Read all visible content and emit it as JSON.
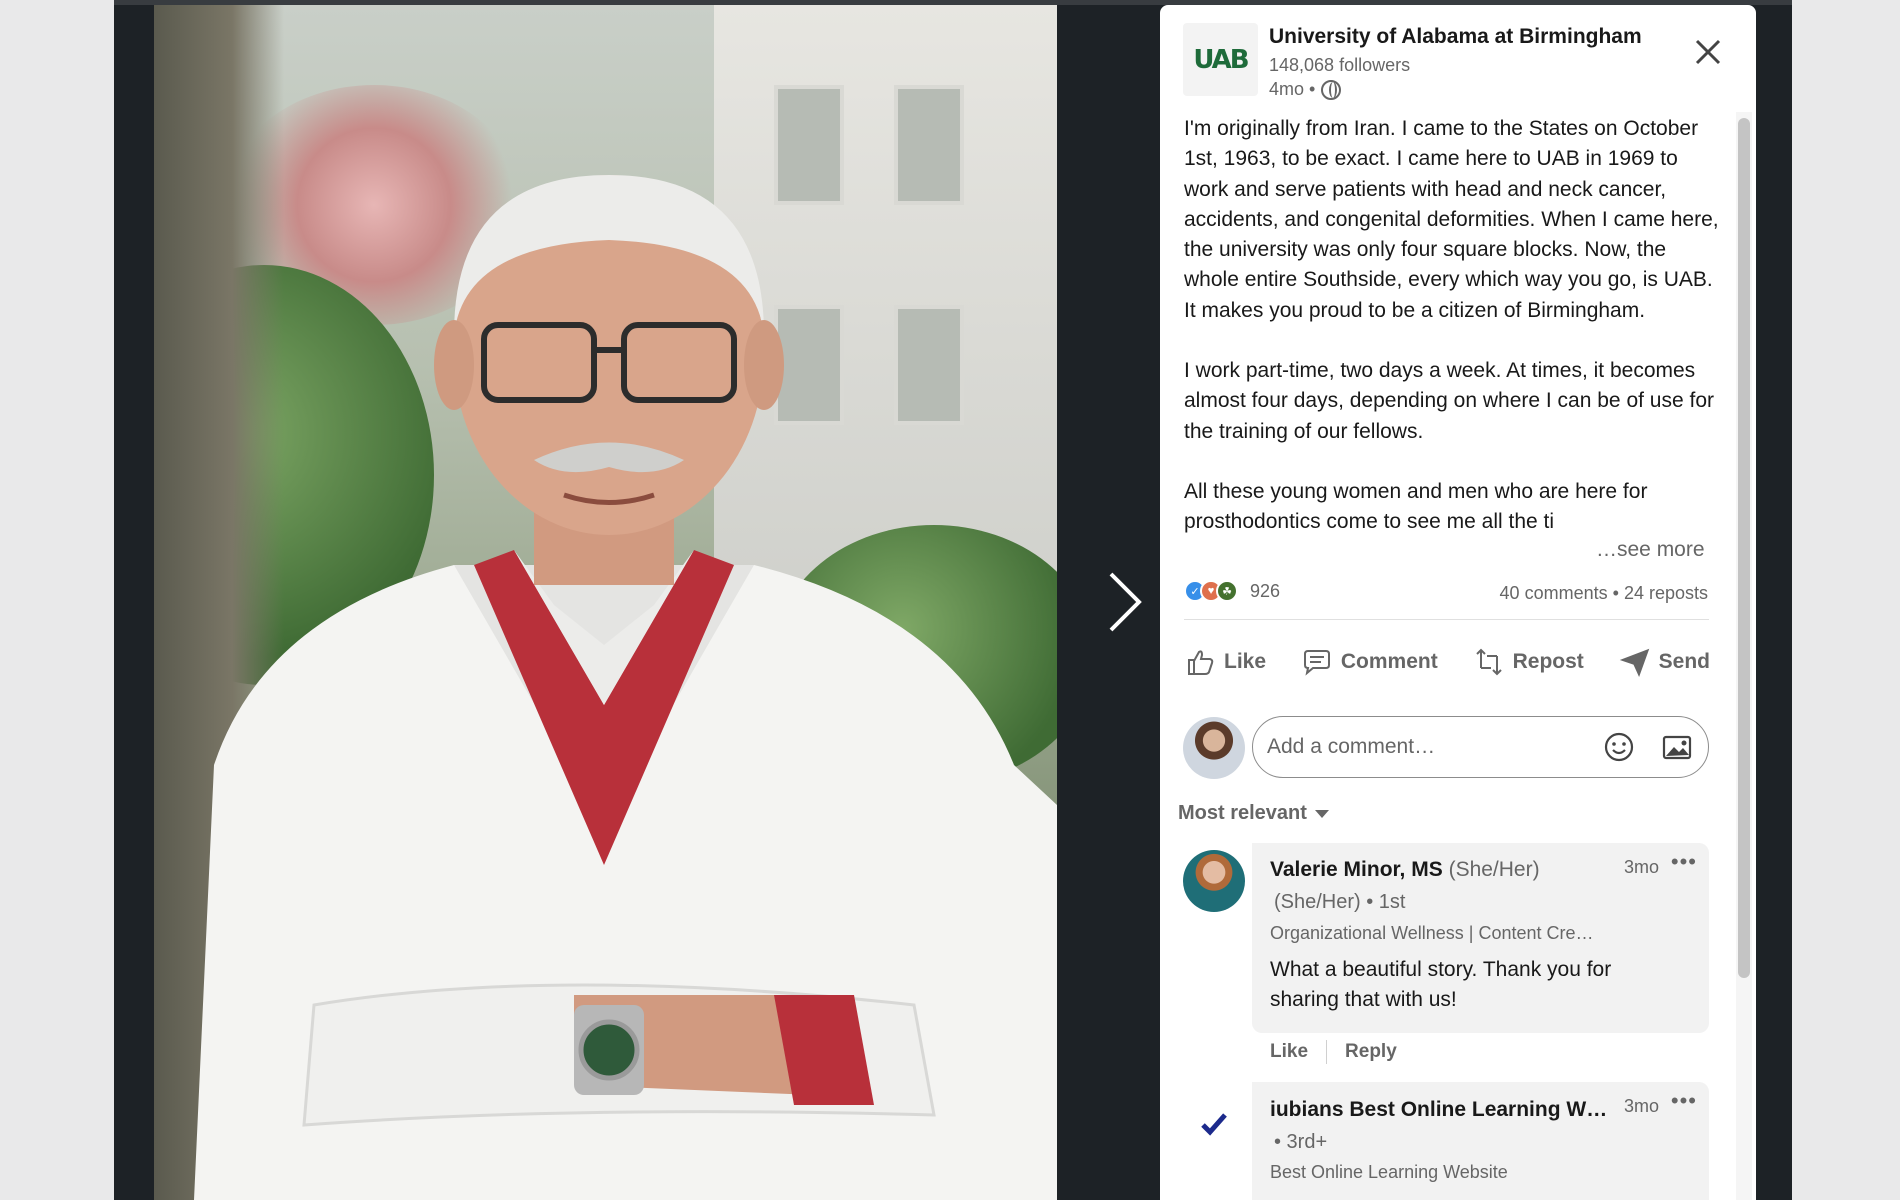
{
  "post": {
    "org_name": "University of Alabama at Birmingham",
    "followers": "148,068 followers",
    "age": "4mo •",
    "logo_text": "UAB",
    "paragraphs": [
      "I'm originally from Iran. I came to the States on October 1st, 1963, to be exact. I came here to UAB in 1969 to work and serve patients with head and neck cancer, accidents, and congenital deformities. When I came here, the university was only four square blocks. Now, the whole entire Southside, every which way you go, is UAB. It makes you proud to be a citizen of Birmingham.",
      "I work part-time, two days a week. At times, it becomes almost four days, depending on where I can be of use for the training of our fellows.",
      "All these young women and men who are here for prosthodontics come to see me all the ti"
    ],
    "see_more": "…see more",
    "reaction_count": "926",
    "comments_count": "40 comments",
    "reposts_count": "24 reposts",
    "counts_separator": "•"
  },
  "actions": {
    "like": "Like",
    "comment": "Comment",
    "repost": "Repost",
    "send": "Send"
  },
  "comment_input": {
    "placeholder": "Add a comment…"
  },
  "sort": {
    "label": "Most relevant"
  },
  "comments": [
    {
      "name": "Valerie Minor, MS",
      "pronouns": "(She/Her)",
      "sub": "(She/Her) • 1st",
      "headline": "Organizational Wellness | Content Cre…",
      "time": "3mo",
      "body": "What a beautiful story. Thank you for sharing that with us!",
      "like": "Like",
      "reply": "Reply"
    },
    {
      "name": "iubians Best Online Learning W…",
      "sub": "• 3rd+",
      "headline": "Best Online Learning Website",
      "time": "3mo"
    }
  ],
  "icons": {
    "close": "close-icon",
    "next": "chevron-right-icon",
    "globe": "globe-icon",
    "emoji": "emoji-icon",
    "image": "image-icon"
  },
  "colors": {
    "accent": "#0a66c2",
    "uab_green": "#1e6b3a",
    "frame_bg": "#1d2226"
  }
}
